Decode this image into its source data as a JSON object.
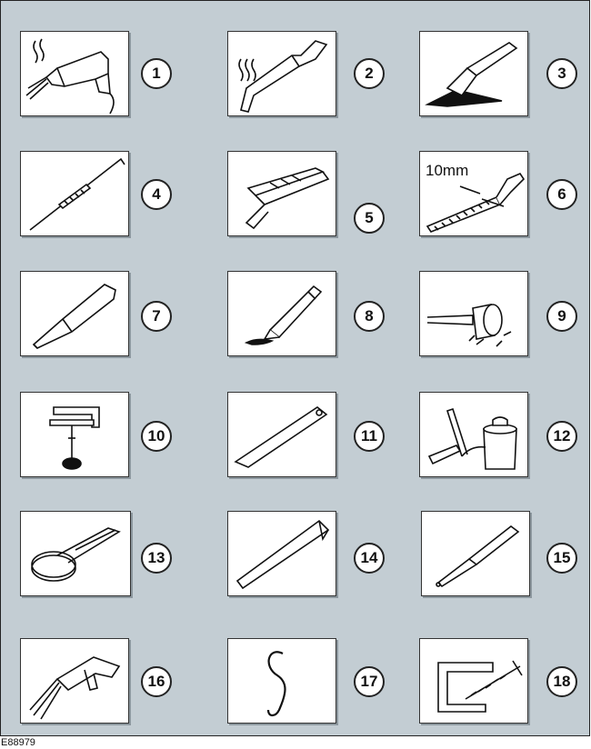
{
  "figure_id": "E88979",
  "callouts": [
    "1",
    "2",
    "3",
    "4",
    "5",
    "6",
    "7",
    "8",
    "9",
    "10",
    "11",
    "12",
    "13",
    "14",
    "15",
    "16",
    "17",
    "18"
  ],
  "dimension_label": "10mm",
  "icons": [
    "heat-gun-icon",
    "soldering-iron-icon",
    "scraper-icon",
    "pick-tool-icon",
    "trim-clip-tool-icon",
    "file-icon",
    "punch-icon",
    "marker-pen-icon",
    "mallet-icon",
    "clamp-stand-icon",
    "wedge-icon",
    "vacuum-cleaner-icon",
    "filter-wrench-icon",
    "plastic-wedge-icon",
    "pin-punch-icon",
    "air-blow-gun-icon",
    "s-hook-icon",
    "g-clamp-icon"
  ]
}
